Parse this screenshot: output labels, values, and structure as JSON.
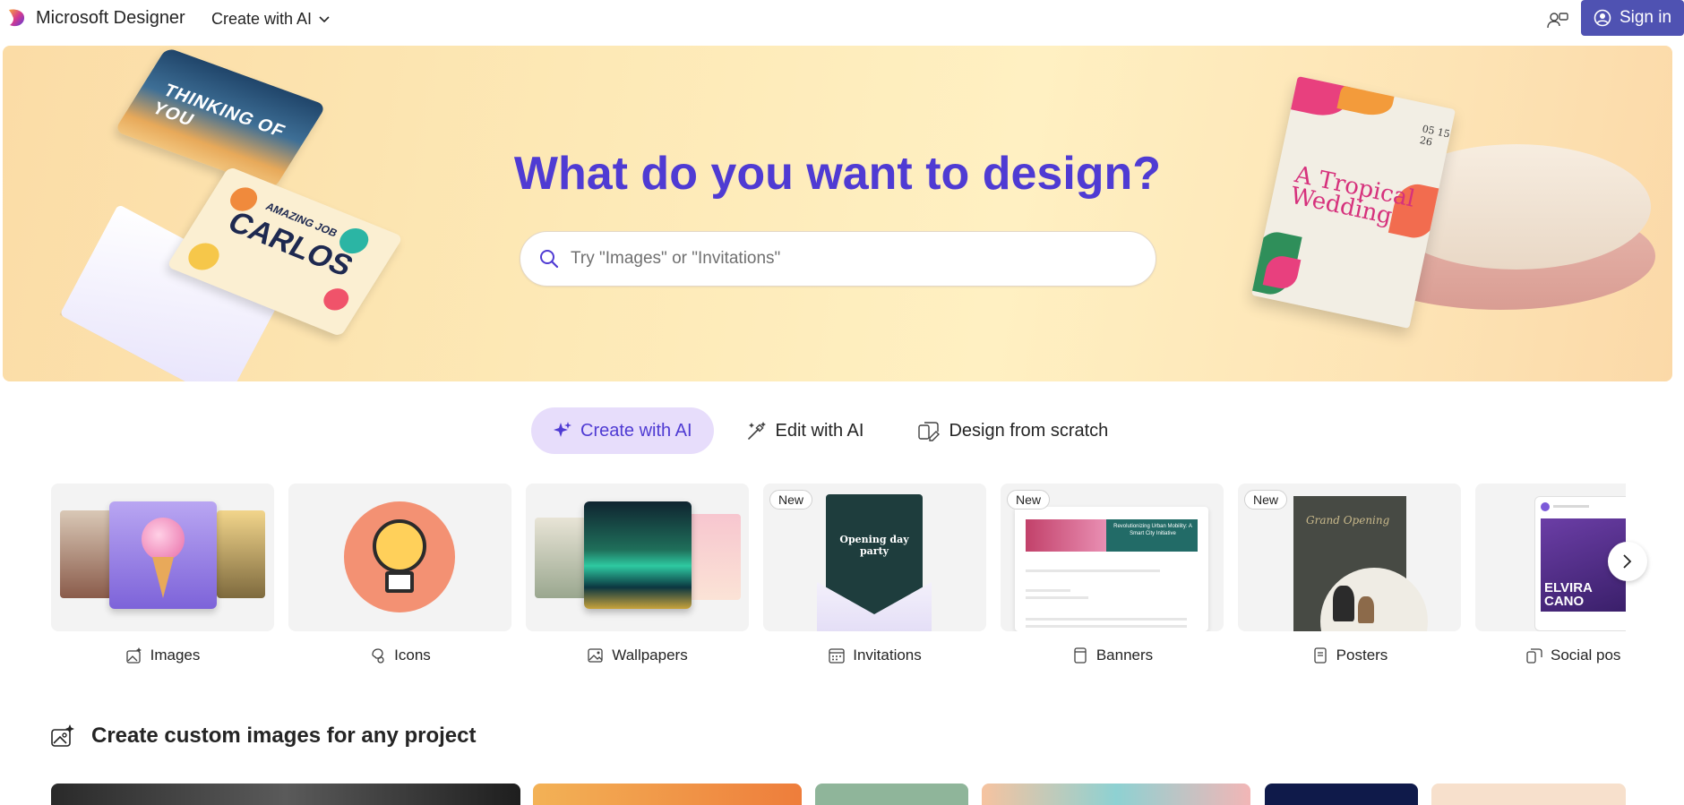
{
  "header": {
    "app_name": "Microsoft Designer",
    "create_menu_label": "Create with AI",
    "sign_in_label": "Sign in",
    "icons": [
      "designer-logo-icon",
      "chevron-down-icon",
      "share-people-icon",
      "person-circle-icon"
    ]
  },
  "hero": {
    "title": "What do you want to design?",
    "search_placeholder": "Try \"Images\" or \"Invitations\"",
    "search_value": "",
    "decor": {
      "card1_text": "THINKING OF YOU",
      "card2_small": "AMAZING JOB",
      "card2_big": "CARLOS",
      "invite_title": "A Tropical Wedding",
      "invite_date": "05 15 26"
    }
  },
  "tabs": [
    {
      "label": "Create with AI",
      "active": true,
      "icon": "sparkle-icon"
    },
    {
      "label": "Edit with AI",
      "active": false,
      "icon": "wand-icon"
    },
    {
      "label": "Design from scratch",
      "active": false,
      "icon": "design-shapes-icon"
    }
  ],
  "categories": [
    {
      "label": "Images",
      "icon": "image-sparkle-icon",
      "badge": ""
    },
    {
      "label": "Icons",
      "icon": "icons-icon",
      "badge": ""
    },
    {
      "label": "Wallpapers",
      "icon": "wallpaper-icon",
      "badge": ""
    },
    {
      "label": "Invitations",
      "icon": "calendar-icon",
      "badge": "New",
      "thumb_text": "Opening day party"
    },
    {
      "label": "Banners",
      "icon": "banner-icon",
      "badge": "New",
      "thumb_text": "Revolutionizing Urban Mobility: A Smart City Initiative"
    },
    {
      "label": "Posters",
      "icon": "poster-icon",
      "badge": "New",
      "thumb_text": "Grand Opening"
    },
    {
      "label": "Social pos",
      "icon": "social-post-icon",
      "badge": "",
      "thumb_text": "ELVIRA CANO"
    }
  ],
  "section": {
    "title": "Create custom images for any project",
    "icon": "image-sparkle-icon"
  },
  "colors": {
    "accent": "#4f3bd3",
    "signin_bg": "#4f52b2",
    "active_tab_bg": "#e7ddfb",
    "hero_bg": "#fde9b6"
  }
}
